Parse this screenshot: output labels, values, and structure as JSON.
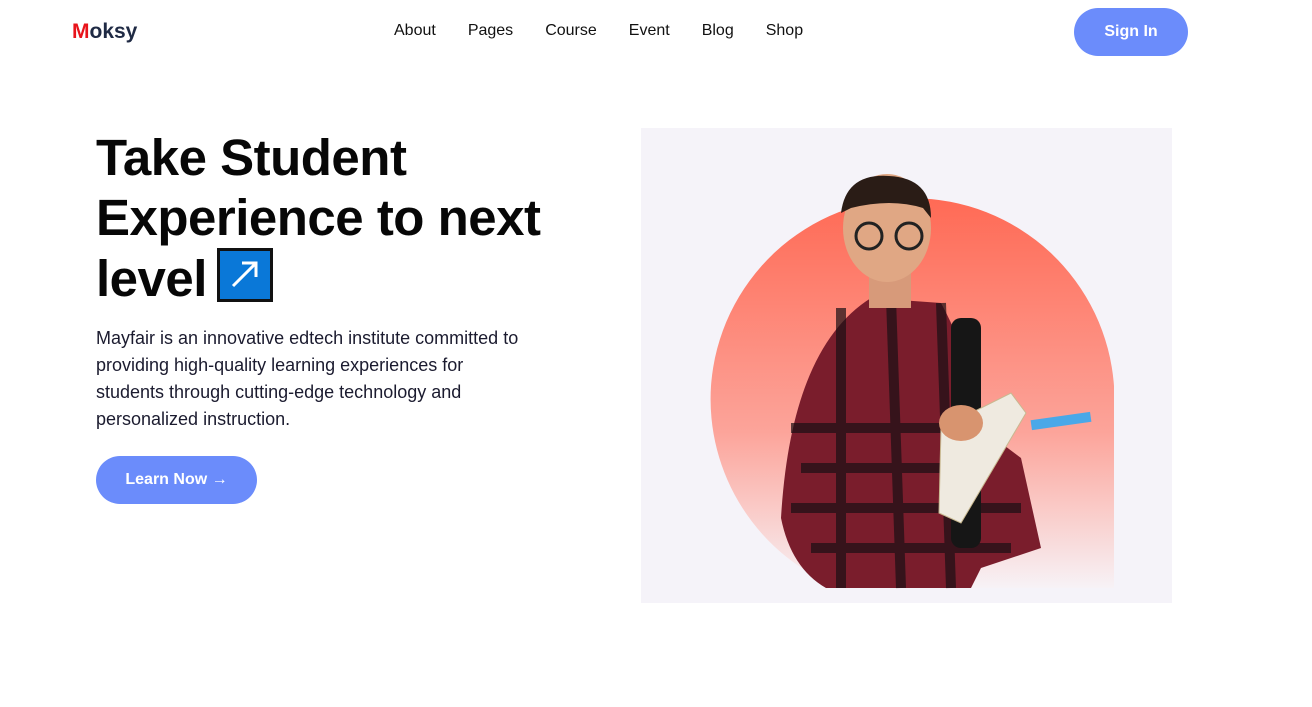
{
  "logo": {
    "first": "M",
    "rest": "oksy"
  },
  "nav": [
    "About",
    "Pages",
    "Course",
    "Event",
    "Blog",
    "Shop"
  ],
  "signin": "Sign In",
  "hero": {
    "title": "Take Student Experience to next level",
    "description": "Mayfair is an innovative edtech institute committed to providing high-quality learning experiences for students through cutting-edge technology and personalized instruction.",
    "cta": "Learn Now →"
  },
  "colors": {
    "accent": "#6b8cfb",
    "logo_red": "#e8141b",
    "icon_blue": "#0a78d8",
    "circle_top": "#ff6a55"
  }
}
